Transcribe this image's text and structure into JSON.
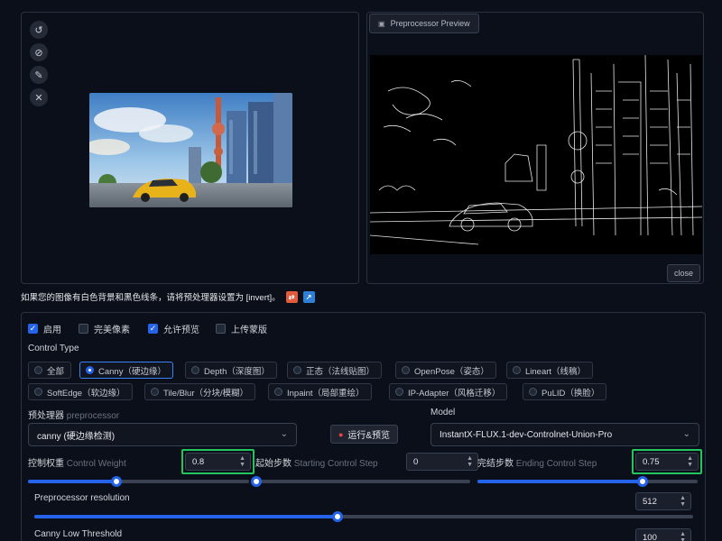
{
  "preview": {
    "title": "Preprocessor Preview",
    "close_label": "close"
  },
  "notice": {
    "text": "如果您的图像有白色背景和黑色线条，请将预处理器设置为 [invert]。"
  },
  "checkboxes": [
    {
      "label": "启用",
      "checked": true
    },
    {
      "label": "完美像素",
      "checked": false
    },
    {
      "label": "允许预览",
      "checked": true
    },
    {
      "label": "上传蒙版",
      "checked": false
    }
  ],
  "control_type": {
    "label": "Control Type",
    "options": [
      "全部",
      "Canny（硬边缘）",
      "Depth（深度图）",
      "正态（法线贴图）",
      "OpenPose（姿态）",
      "Lineart（线稿）",
      "SoftEdge（软边缘）",
      "Tile/Blur（分块/模糊）",
      "Inpaint（局部重绘）",
      "IP-Adapter（风格迁移）",
      "PuLID（换脸）"
    ],
    "selected": "Canny（硬边缘）"
  },
  "preprocessor": {
    "label": "预处理器",
    "sub": "preprocessor",
    "value": "canny (硬边缘检测)"
  },
  "run_button": {
    "label": "运行&预览"
  },
  "model": {
    "label": "Model",
    "value": "InstantX-FLUX.1-dev-Controlnet-Union-Pro"
  },
  "control_weight": {
    "label": "控制权重",
    "sub": "Control Weight",
    "value": "0.8",
    "slider": 0.4
  },
  "start_step": {
    "label": "起始步数",
    "sub": "Starting Control Step",
    "value": "0",
    "slider": 0.0
  },
  "end_step": {
    "label": "完结步数",
    "sub": "Ending Control Step",
    "value": "0.75",
    "slider": 0.75
  },
  "resolution": {
    "label": "Preprocessor resolution",
    "value": "512",
    "slider": 0.46
  },
  "canny_low": {
    "label": "Canny Low Threshold",
    "value": "100"
  },
  "colors": {
    "accent": "#2563eb",
    "highlight": "#22c55e",
    "background": "#0b0f19"
  }
}
